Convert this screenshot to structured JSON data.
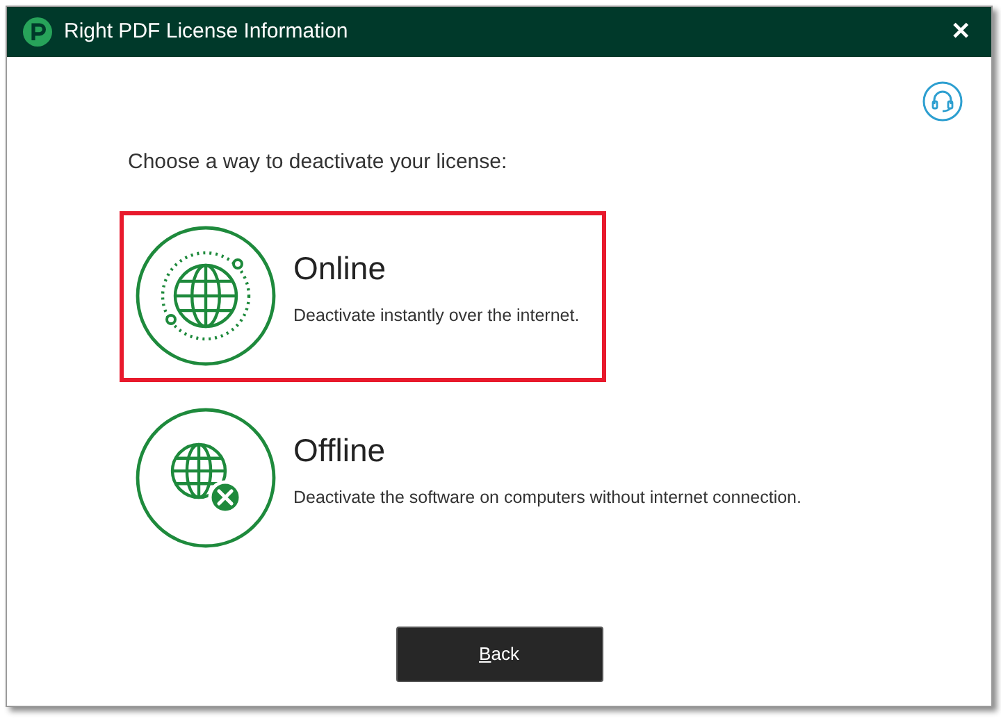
{
  "window": {
    "title": "Right PDF License Information",
    "close": "✕"
  },
  "prompt": "Choose a way to deactivate your license:",
  "options": [
    {
      "kind": "online",
      "title": "Online",
      "description": "Deactivate instantly over the internet.",
      "selected": true
    },
    {
      "kind": "offline",
      "title": "Offline",
      "description": "Deactivate the software on computers without internet connection.",
      "selected": false
    }
  ],
  "buttons": [
    "Back"
  ]
}
